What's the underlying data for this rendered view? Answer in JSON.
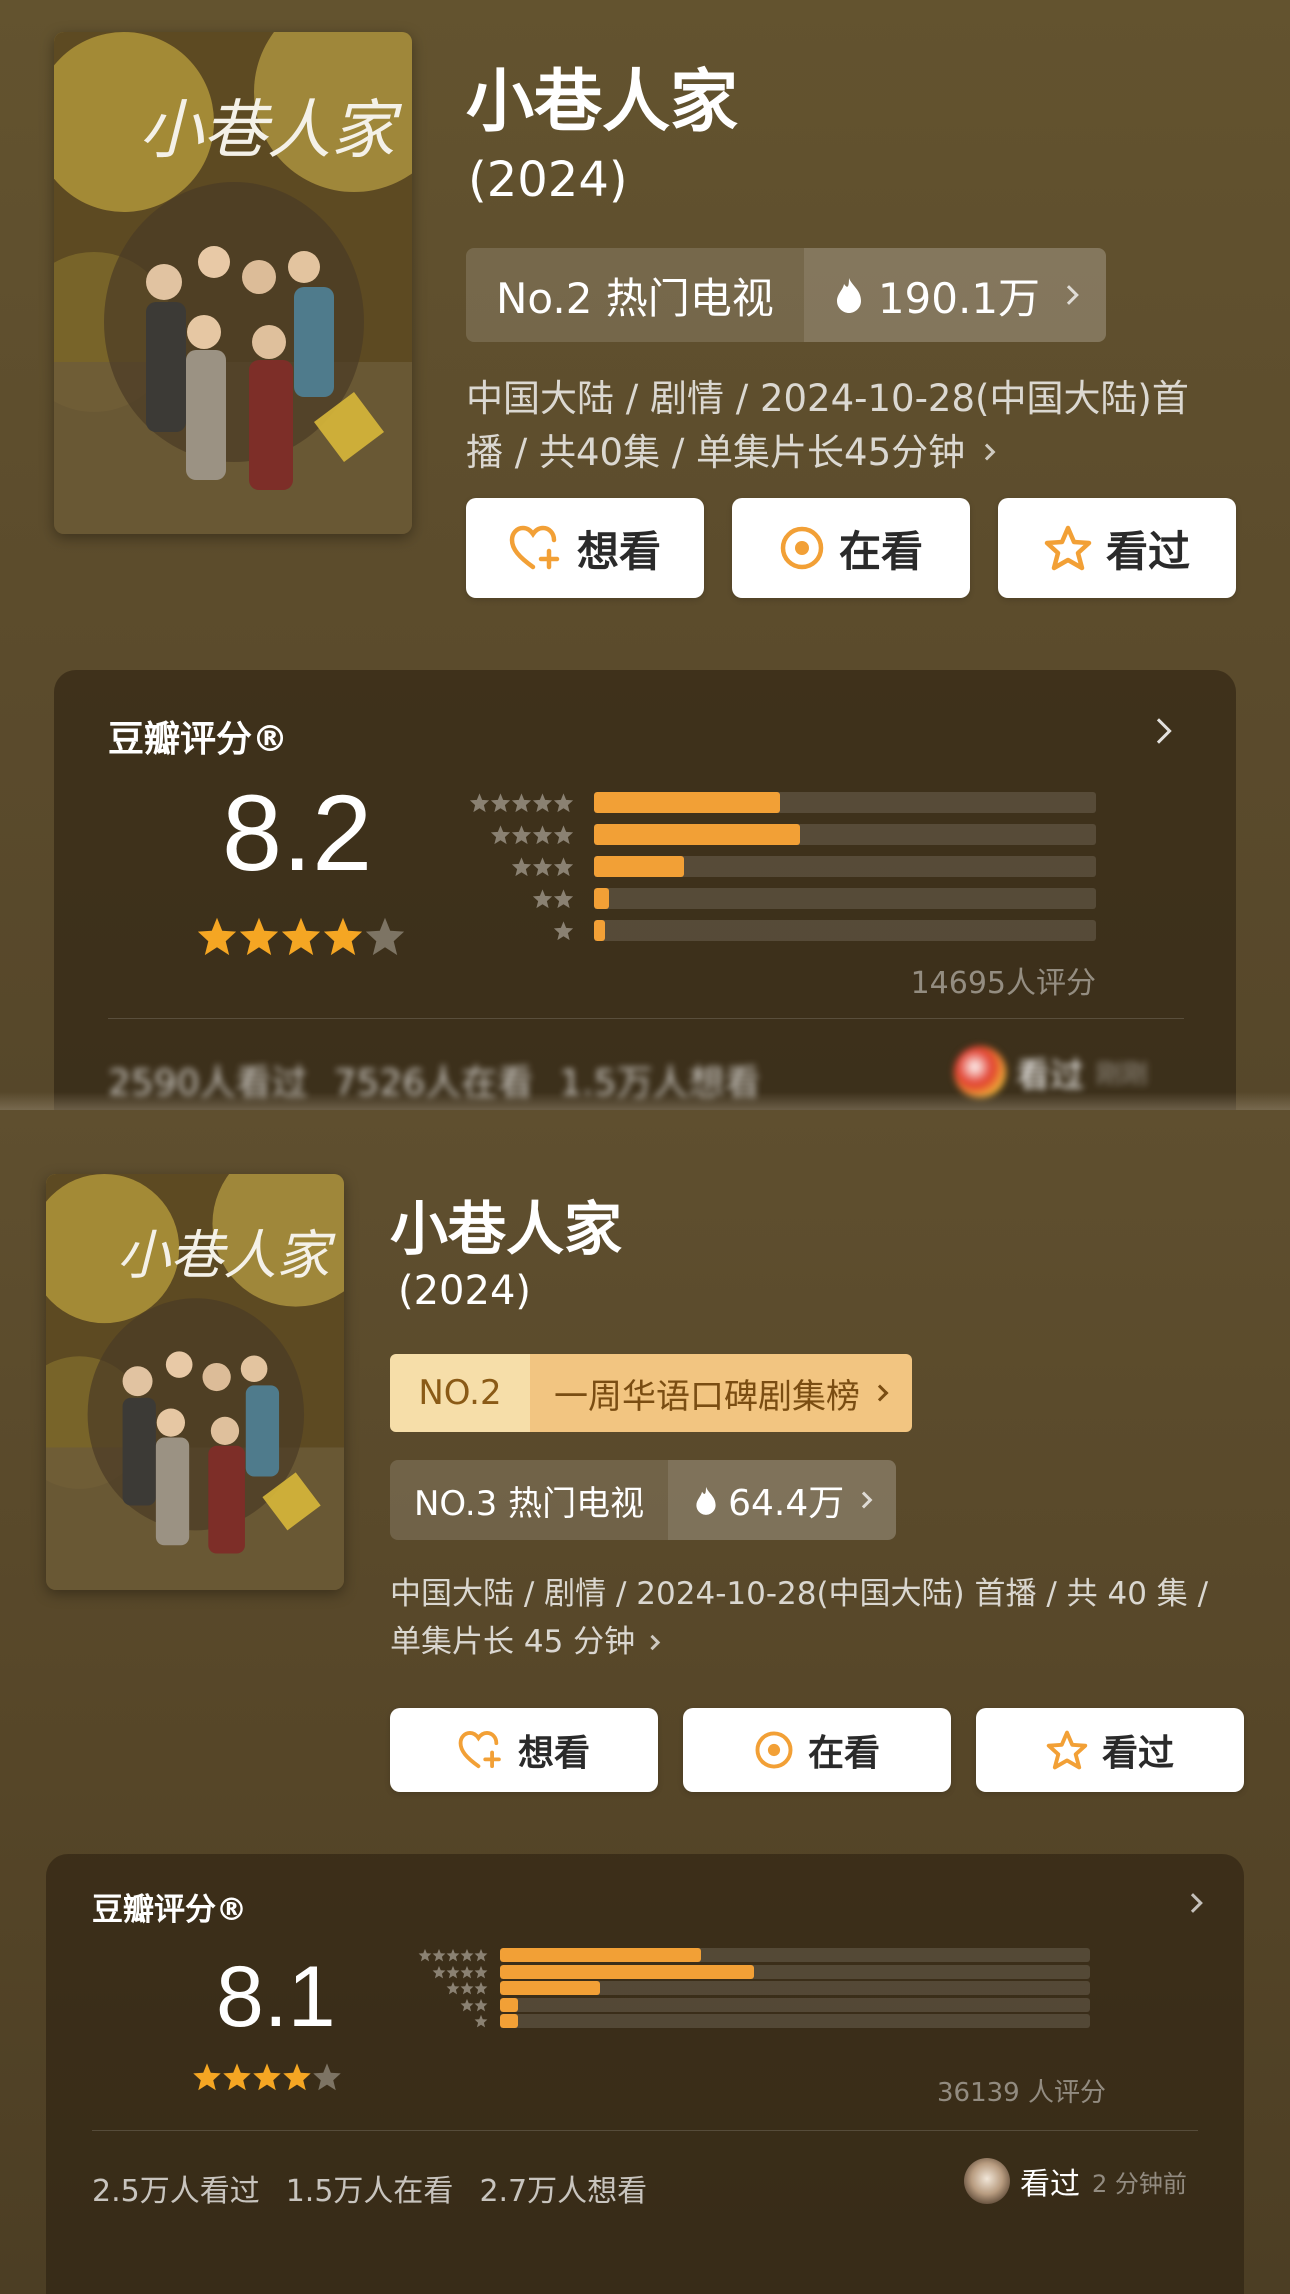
{
  "card1": {
    "title": "小巷人家",
    "year": "(2024)",
    "rank_label": "No.2 热门电视",
    "heat": "190.1万",
    "meta_line1": "中国大陆 / 剧情 / 2024-10-28(中国大陆)首",
    "meta_line2": "播 / 共40集 / 单集片长45分钟",
    "buttons": {
      "want": "想看",
      "watching": "在看",
      "watched": "看过"
    },
    "rating_title": "豆瓣评分®",
    "score": "8.2",
    "star_fill": 4,
    "distribution": [
      0.37,
      0.41,
      0.18,
      0.03,
      0.02
    ],
    "rating_count": "14695人评分",
    "stats": {
      "watched": "2590人看过",
      "watching": "7526人在看",
      "want": "1.5万人想看"
    },
    "friend_status": "看过",
    "friend_time": "刚刚"
  },
  "card2": {
    "title": "小巷人家",
    "year": "(2024)",
    "badge_no": "NO.2",
    "badge_text": "一周华语口碑剧集榜",
    "rank_label": "NO.3 热门电视",
    "heat": "64.4万",
    "meta_line1": "中国大陆 / 剧情 / 2024-10-28(中国大陆) 首播 / 共 40 集 /",
    "meta_line2": "单集片长 45 分钟",
    "buttons": {
      "want": "想看",
      "watching": "在看",
      "watched": "看过"
    },
    "rating_title": "豆瓣评分®",
    "score": "8.1",
    "star_fill": 4,
    "distribution": [
      0.34,
      0.43,
      0.17,
      0.03,
      0.03
    ],
    "rating_count": "36139 人评分",
    "stats": {
      "watched": "2.5万人看过",
      "watching": "1.5万人在看",
      "want": "2.7万人想看"
    },
    "friend_status": "看过",
    "friend_time": "2 分钟前"
  },
  "colors": {
    "accent": "#f2a036",
    "star": "#f5a623",
    "star_empty": "#7d7464"
  },
  "icons": {
    "want": "heart-plus-icon",
    "watching": "target-icon",
    "watched": "star-outline-icon",
    "heat": "flame-icon"
  }
}
